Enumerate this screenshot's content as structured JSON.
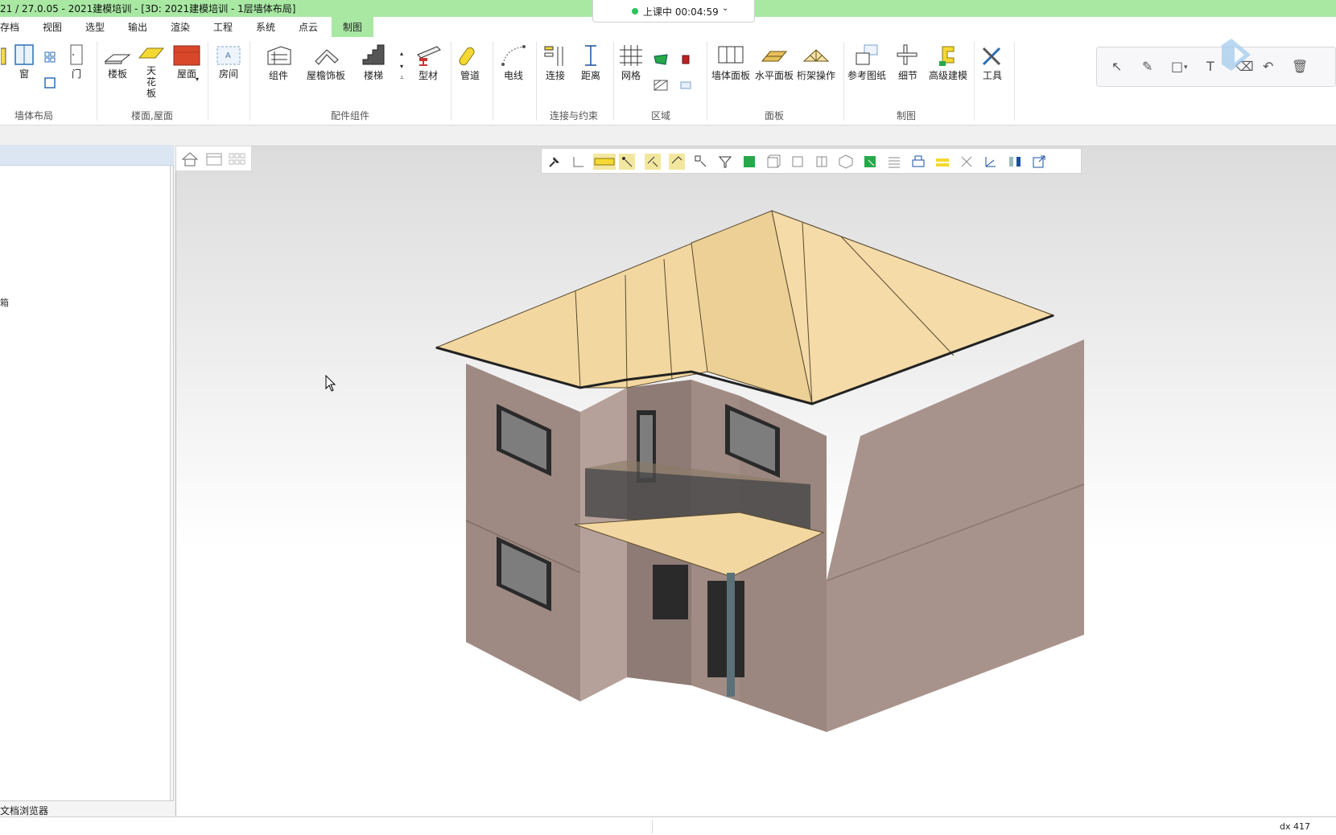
{
  "window": {
    "title": "21 / 27.0.05 - 2021建模培训 - [3D: 2021建模培训 - 1层墙体布局]"
  },
  "menu": {
    "items": [
      "存档",
      "视图",
      "选型",
      "输出",
      "渲染",
      "工程",
      "系统",
      "点云",
      "制图"
    ],
    "active": "制图"
  },
  "session": {
    "status": "上课中 00:04:59"
  },
  "ribbon": {
    "groups": {
      "wall_layout": "墙体布局",
      "floor_roof": "楼面,屋面",
      "components": "配件组件",
      "connect": "连接与约束",
      "area": "区域",
      "panel": "面板",
      "drafting": "制图"
    },
    "tools": {
      "window": "窗",
      "door": "门",
      "slab": "楼板",
      "ceiling": "天花板",
      "roof": "屋面",
      "room": "房间",
      "component": "组件",
      "eave_trim": "屋檐饰板",
      "stair": "楼梯",
      "profile": "型材",
      "pipe": "管道",
      "wire": "电线",
      "connect": "连接",
      "distance": "距离",
      "grid": "网格",
      "wall_panel": "墙体面板",
      "horizontal_panel": "水平面板",
      "truss_op": "桁架操作",
      "ref_drawing": "参考图纸",
      "detail": "细节",
      "advanced": "高级建模",
      "tools": "工具"
    },
    "colors": {
      "accent": "#a8e8a3",
      "roof_red": "#d9472b",
      "ceiling_yellow": "#f5d832"
    }
  },
  "left_panel": {
    "bottom_tab": "文档浏览器",
    "stray_char": "箱"
  },
  "statusbar": {
    "dx": "dx 417"
  },
  "scene": {
    "wall_color": "#a8938c",
    "roof_color": "#f2d7a0",
    "window_glass": "#7d7d7d"
  }
}
